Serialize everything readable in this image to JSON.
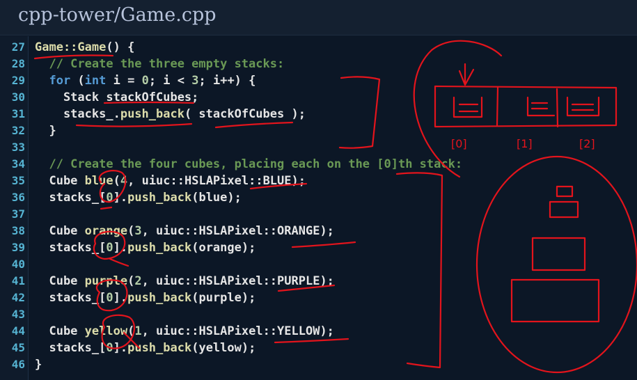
{
  "title": "cpp-tower/Game.cpp",
  "colors": {
    "background": "#0c1726",
    "keyword": "#569cd6",
    "comment": "#6a9955",
    "number": "#b5cea8",
    "function": "#dcdcaa",
    "line_number": "#56b4d3",
    "annotation": "#e3141c"
  },
  "annotation_labels": [
    "[0]",
    "[1]",
    "[2]"
  ],
  "lines": [
    {
      "n": "27",
      "tokens": [
        {
          "t": "Game::Game",
          "c": "fn"
        },
        {
          "t": "() {",
          "c": "pl"
        }
      ]
    },
    {
      "n": "28",
      "tokens": [
        {
          "t": "  // Create the three empty stacks:",
          "c": "cm"
        }
      ]
    },
    {
      "n": "29",
      "tokens": [
        {
          "t": "  for",
          "c": "kw"
        },
        {
          "t": " (",
          "c": "pl"
        },
        {
          "t": "int",
          "c": "kw"
        },
        {
          "t": " i = ",
          "c": "pl"
        },
        {
          "t": "0",
          "c": "num"
        },
        {
          "t": "; i < ",
          "c": "pl"
        },
        {
          "t": "3",
          "c": "num"
        },
        {
          "t": "; i++) {",
          "c": "pl"
        }
      ]
    },
    {
      "n": "30",
      "tokens": [
        {
          "t": "    Stack stackOfCubes;",
          "c": "pl"
        }
      ]
    },
    {
      "n": "31",
      "tokens": [
        {
          "t": "    stacks_.",
          "c": "pl"
        },
        {
          "t": "push_back",
          "c": "fn"
        },
        {
          "t": "( stackOfCubes );",
          "c": "pl"
        }
      ]
    },
    {
      "n": "32",
      "tokens": [
        {
          "t": "  }",
          "c": "pl"
        }
      ]
    },
    {
      "n": "33",
      "tokens": []
    },
    {
      "n": "34",
      "tokens": [
        {
          "t": "  // Create the four cubes, placing each on the [0]th stack:",
          "c": "cm"
        }
      ]
    },
    {
      "n": "35",
      "tokens": [
        {
          "t": "  Cube ",
          "c": "pl"
        },
        {
          "t": "blue",
          "c": "fn"
        },
        {
          "t": "(",
          "c": "pl"
        },
        {
          "t": "4",
          "c": "num"
        },
        {
          "t": ", uiuc::HSLAPixel::BLUE);",
          "c": "pl"
        }
      ]
    },
    {
      "n": "36",
      "tokens": [
        {
          "t": "  stacks_[",
          "c": "pl"
        },
        {
          "t": "0",
          "c": "num"
        },
        {
          "t": "].",
          "c": "pl"
        },
        {
          "t": "push_back",
          "c": "fn"
        },
        {
          "t": "(blue);",
          "c": "pl"
        }
      ]
    },
    {
      "n": "37",
      "tokens": []
    },
    {
      "n": "38",
      "tokens": [
        {
          "t": "  Cube ",
          "c": "pl"
        },
        {
          "t": "orange",
          "c": "fn"
        },
        {
          "t": "(",
          "c": "pl"
        },
        {
          "t": "3",
          "c": "num"
        },
        {
          "t": ", uiuc::HSLAPixel::ORANGE);",
          "c": "pl"
        }
      ]
    },
    {
      "n": "39",
      "tokens": [
        {
          "t": "  stacks_[",
          "c": "pl"
        },
        {
          "t": "0",
          "c": "num"
        },
        {
          "t": "].",
          "c": "pl"
        },
        {
          "t": "push_back",
          "c": "fn"
        },
        {
          "t": "(orange);",
          "c": "pl"
        }
      ]
    },
    {
      "n": "40",
      "tokens": []
    },
    {
      "n": "41",
      "tokens": [
        {
          "t": "  Cube ",
          "c": "pl"
        },
        {
          "t": "purple",
          "c": "fn"
        },
        {
          "t": "(",
          "c": "pl"
        },
        {
          "t": "2",
          "c": "num"
        },
        {
          "t": ", uiuc::HSLAPixel::PURPLE);",
          "c": "pl"
        }
      ]
    },
    {
      "n": "42",
      "tokens": [
        {
          "t": "  stacks_[",
          "c": "pl"
        },
        {
          "t": "0",
          "c": "num"
        },
        {
          "t": "].",
          "c": "pl"
        },
        {
          "t": "push_back",
          "c": "fn"
        },
        {
          "t": "(purple);",
          "c": "pl"
        }
      ]
    },
    {
      "n": "43",
      "tokens": []
    },
    {
      "n": "44",
      "tokens": [
        {
          "t": "  Cube ",
          "c": "pl"
        },
        {
          "t": "yellow",
          "c": "fn"
        },
        {
          "t": "(",
          "c": "pl"
        },
        {
          "t": "1",
          "c": "num"
        },
        {
          "t": ", uiuc::HSLAPixel::YELLOW);",
          "c": "pl"
        }
      ]
    },
    {
      "n": "45",
      "tokens": [
        {
          "t": "  stacks_[",
          "c": "pl"
        },
        {
          "t": "0",
          "c": "num"
        },
        {
          "t": "].",
          "c": "pl"
        },
        {
          "t": "push_back",
          "c": "fn"
        },
        {
          "t": "(yellow);",
          "c": "pl"
        }
      ]
    },
    {
      "n": "46",
      "tokens": [
        {
          "t": "}",
          "c": "pl"
        }
      ]
    }
  ]
}
